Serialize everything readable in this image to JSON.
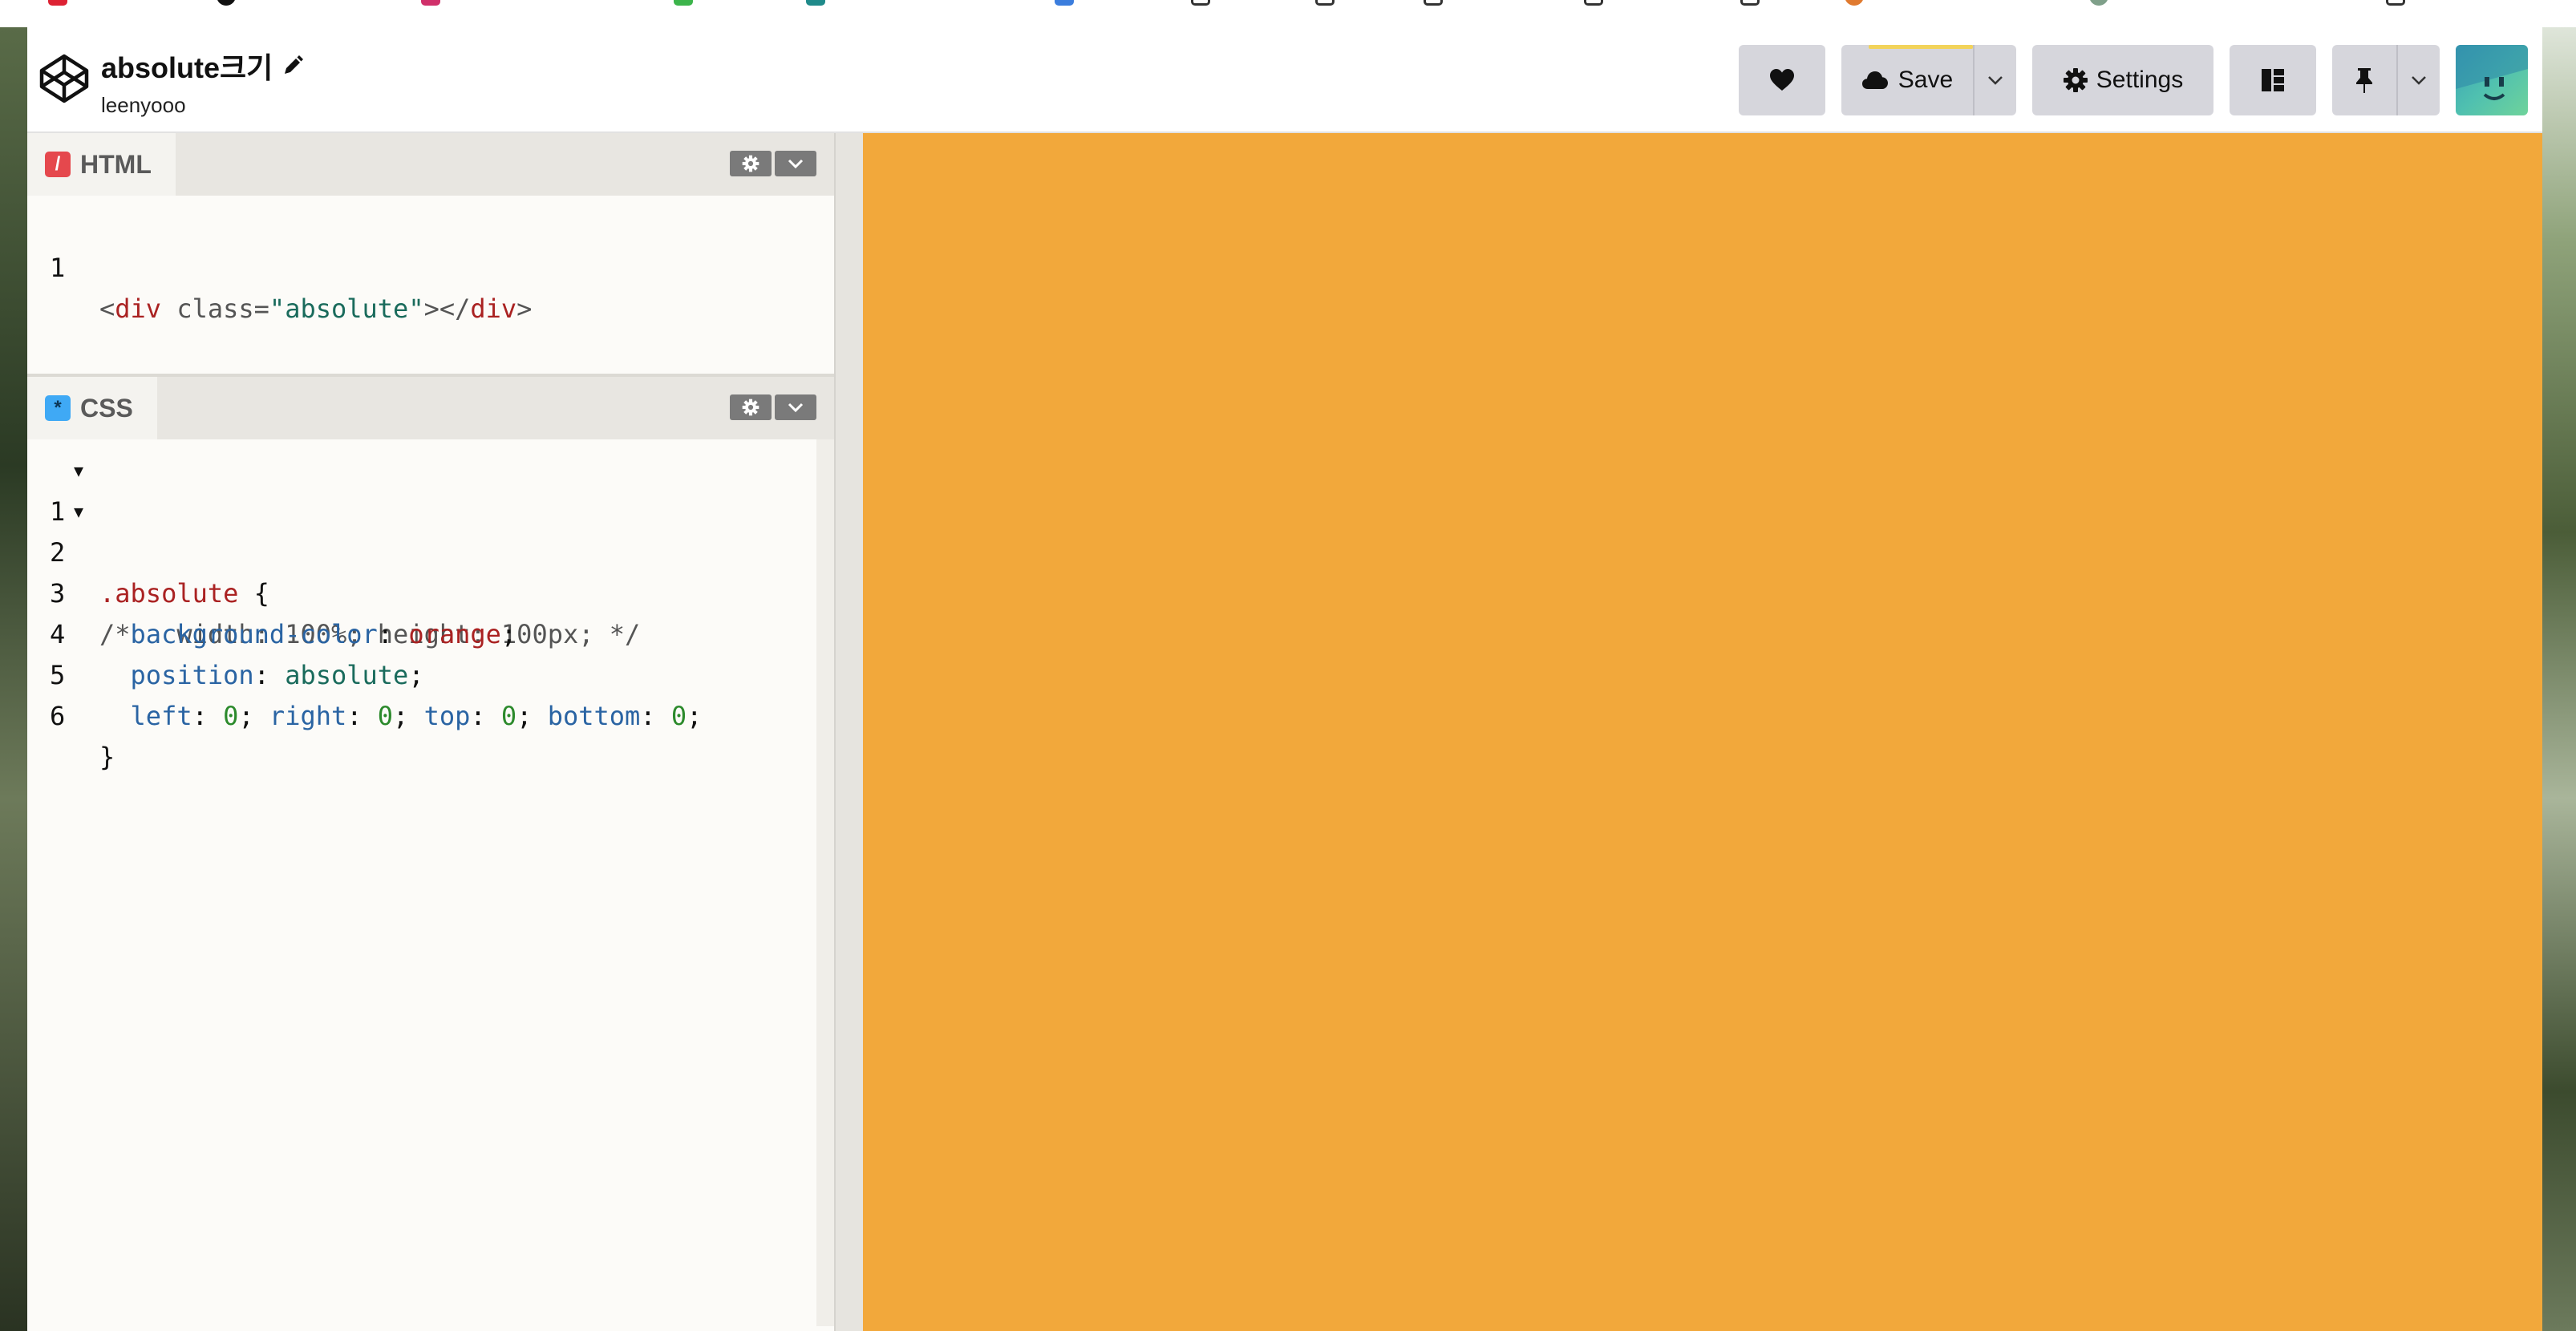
{
  "pen": {
    "title": "absolute크기",
    "owner": "leenyooo"
  },
  "toolbar": {
    "save_label": "Save",
    "settings_label": "Settings"
  },
  "icons": {
    "logo": "codepen-logo-icon",
    "love": "heart-icon",
    "save": "cloud-icon",
    "settings": "gear-icon",
    "layout": "layout-icon",
    "pin": "pin-icon",
    "pencil": "pencil-icon"
  },
  "colors": {
    "preview_background": "#f2a83b",
    "html_badge": "#e5484d",
    "css_badge": "#3fa9f5",
    "save_progress": "#f2d35b"
  },
  "editors": {
    "html": {
      "tab_label": "HTML",
      "badge": "/",
      "lines": [
        {
          "num": "1",
          "text": "<div class=\"absolute\"></div>"
        }
      ]
    },
    "css": {
      "tab_label": "CSS",
      "badge": "*",
      "lines": [
        {
          "num": "1",
          "text": ".absolute {"
        },
        {
          "num": "2",
          "text": "/*   width: 100%; height: 100px; */"
        },
        {
          "num": "3",
          "text": "  background-color: orange;"
        },
        {
          "num": "4",
          "text": "  position: absolute;"
        },
        {
          "num": "5",
          "text": "  left: 0; right: 0; top: 0; bottom: 0;"
        },
        {
          "num": "6",
          "text": "}"
        }
      ]
    }
  }
}
